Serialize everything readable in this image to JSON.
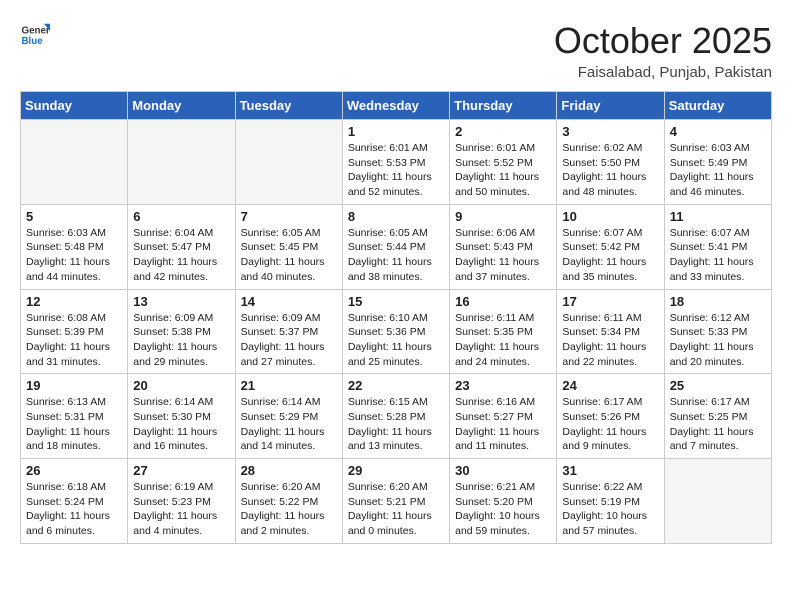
{
  "header": {
    "logo_general": "General",
    "logo_blue": "Blue",
    "month": "October 2025",
    "location": "Faisalabad, Punjab, Pakistan"
  },
  "weekdays": [
    "Sunday",
    "Monday",
    "Tuesday",
    "Wednesday",
    "Thursday",
    "Friday",
    "Saturday"
  ],
  "weeks": [
    [
      {
        "day": "",
        "sunrise": "",
        "sunset": "",
        "daylight": "",
        "empty": true
      },
      {
        "day": "",
        "sunrise": "",
        "sunset": "",
        "daylight": "",
        "empty": true
      },
      {
        "day": "",
        "sunrise": "",
        "sunset": "",
        "daylight": "",
        "empty": true
      },
      {
        "day": "1",
        "sunrise": "Sunrise: 6:01 AM",
        "sunset": "Sunset: 5:53 PM",
        "daylight": "Daylight: 11 hours and 52 minutes."
      },
      {
        "day": "2",
        "sunrise": "Sunrise: 6:01 AM",
        "sunset": "Sunset: 5:52 PM",
        "daylight": "Daylight: 11 hours and 50 minutes."
      },
      {
        "day": "3",
        "sunrise": "Sunrise: 6:02 AM",
        "sunset": "Sunset: 5:50 PM",
        "daylight": "Daylight: 11 hours and 48 minutes."
      },
      {
        "day": "4",
        "sunrise": "Sunrise: 6:03 AM",
        "sunset": "Sunset: 5:49 PM",
        "daylight": "Daylight: 11 hours and 46 minutes."
      }
    ],
    [
      {
        "day": "5",
        "sunrise": "Sunrise: 6:03 AM",
        "sunset": "Sunset: 5:48 PM",
        "daylight": "Daylight: 11 hours and 44 minutes."
      },
      {
        "day": "6",
        "sunrise": "Sunrise: 6:04 AM",
        "sunset": "Sunset: 5:47 PM",
        "daylight": "Daylight: 11 hours and 42 minutes."
      },
      {
        "day": "7",
        "sunrise": "Sunrise: 6:05 AM",
        "sunset": "Sunset: 5:45 PM",
        "daylight": "Daylight: 11 hours and 40 minutes."
      },
      {
        "day": "8",
        "sunrise": "Sunrise: 6:05 AM",
        "sunset": "Sunset: 5:44 PM",
        "daylight": "Daylight: 11 hours and 38 minutes."
      },
      {
        "day": "9",
        "sunrise": "Sunrise: 6:06 AM",
        "sunset": "Sunset: 5:43 PM",
        "daylight": "Daylight: 11 hours and 37 minutes."
      },
      {
        "day": "10",
        "sunrise": "Sunrise: 6:07 AM",
        "sunset": "Sunset: 5:42 PM",
        "daylight": "Daylight: 11 hours and 35 minutes."
      },
      {
        "day": "11",
        "sunrise": "Sunrise: 6:07 AM",
        "sunset": "Sunset: 5:41 PM",
        "daylight": "Daylight: 11 hours and 33 minutes."
      }
    ],
    [
      {
        "day": "12",
        "sunrise": "Sunrise: 6:08 AM",
        "sunset": "Sunset: 5:39 PM",
        "daylight": "Daylight: 11 hours and 31 minutes."
      },
      {
        "day": "13",
        "sunrise": "Sunrise: 6:09 AM",
        "sunset": "Sunset: 5:38 PM",
        "daylight": "Daylight: 11 hours and 29 minutes."
      },
      {
        "day": "14",
        "sunrise": "Sunrise: 6:09 AM",
        "sunset": "Sunset: 5:37 PM",
        "daylight": "Daylight: 11 hours and 27 minutes."
      },
      {
        "day": "15",
        "sunrise": "Sunrise: 6:10 AM",
        "sunset": "Sunset: 5:36 PM",
        "daylight": "Daylight: 11 hours and 25 minutes."
      },
      {
        "day": "16",
        "sunrise": "Sunrise: 6:11 AM",
        "sunset": "Sunset: 5:35 PM",
        "daylight": "Daylight: 11 hours and 24 minutes."
      },
      {
        "day": "17",
        "sunrise": "Sunrise: 6:11 AM",
        "sunset": "Sunset: 5:34 PM",
        "daylight": "Daylight: 11 hours and 22 minutes."
      },
      {
        "day": "18",
        "sunrise": "Sunrise: 6:12 AM",
        "sunset": "Sunset: 5:33 PM",
        "daylight": "Daylight: 11 hours and 20 minutes."
      }
    ],
    [
      {
        "day": "19",
        "sunrise": "Sunrise: 6:13 AM",
        "sunset": "Sunset: 5:31 PM",
        "daylight": "Daylight: 11 hours and 18 minutes."
      },
      {
        "day": "20",
        "sunrise": "Sunrise: 6:14 AM",
        "sunset": "Sunset: 5:30 PM",
        "daylight": "Daylight: 11 hours and 16 minutes."
      },
      {
        "day": "21",
        "sunrise": "Sunrise: 6:14 AM",
        "sunset": "Sunset: 5:29 PM",
        "daylight": "Daylight: 11 hours and 14 minutes."
      },
      {
        "day": "22",
        "sunrise": "Sunrise: 6:15 AM",
        "sunset": "Sunset: 5:28 PM",
        "daylight": "Daylight: 11 hours and 13 minutes."
      },
      {
        "day": "23",
        "sunrise": "Sunrise: 6:16 AM",
        "sunset": "Sunset: 5:27 PM",
        "daylight": "Daylight: 11 hours and 11 minutes."
      },
      {
        "day": "24",
        "sunrise": "Sunrise: 6:17 AM",
        "sunset": "Sunset: 5:26 PM",
        "daylight": "Daylight: 11 hours and 9 minutes."
      },
      {
        "day": "25",
        "sunrise": "Sunrise: 6:17 AM",
        "sunset": "Sunset: 5:25 PM",
        "daylight": "Daylight: 11 hours and 7 minutes."
      }
    ],
    [
      {
        "day": "26",
        "sunrise": "Sunrise: 6:18 AM",
        "sunset": "Sunset: 5:24 PM",
        "daylight": "Daylight: 11 hours and 6 minutes."
      },
      {
        "day": "27",
        "sunrise": "Sunrise: 6:19 AM",
        "sunset": "Sunset: 5:23 PM",
        "daylight": "Daylight: 11 hours and 4 minutes."
      },
      {
        "day": "28",
        "sunrise": "Sunrise: 6:20 AM",
        "sunset": "Sunset: 5:22 PM",
        "daylight": "Daylight: 11 hours and 2 minutes."
      },
      {
        "day": "29",
        "sunrise": "Sunrise: 6:20 AM",
        "sunset": "Sunset: 5:21 PM",
        "daylight": "Daylight: 11 hours and 0 minutes."
      },
      {
        "day": "30",
        "sunrise": "Sunrise: 6:21 AM",
        "sunset": "Sunset: 5:20 PM",
        "daylight": "Daylight: 10 hours and 59 minutes."
      },
      {
        "day": "31",
        "sunrise": "Sunrise: 6:22 AM",
        "sunset": "Sunset: 5:19 PM",
        "daylight": "Daylight: 10 hours and 57 minutes."
      },
      {
        "day": "",
        "sunrise": "",
        "sunset": "",
        "daylight": "",
        "empty": true
      }
    ]
  ]
}
